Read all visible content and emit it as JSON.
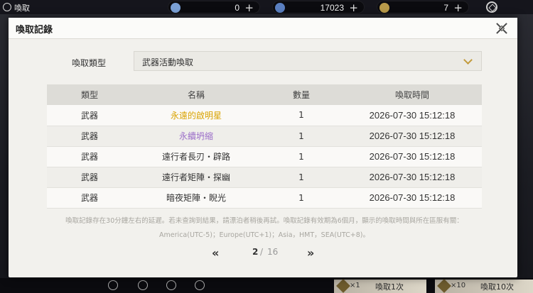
{
  "topbar": {
    "title": "喚取",
    "currencies": [
      {
        "icon": "crystal-icon",
        "value": "0",
        "color": "#7aa0d6"
      },
      {
        "icon": "star-shard-icon",
        "value": "17023",
        "color": "#5a7fc0"
      },
      {
        "icon": "weapon-ticket-icon",
        "value": "7",
        "color": "#b89a4a"
      }
    ]
  },
  "modal": {
    "title": "喚取記錄",
    "type_label": "喚取類型",
    "type_value": "武器活動喚取",
    "columns": [
      "類型",
      "名稱",
      "數量",
      "喚取時間"
    ],
    "rows": [
      {
        "type": "武器",
        "name": "永遠的啟明星",
        "qty": "1",
        "time": "2026-07-30 15:12:18",
        "rarity": "gold"
      },
      {
        "type": "武器",
        "name": "永續坍縮",
        "qty": "1",
        "time": "2026-07-30 15:12:18",
        "rarity": "purple"
      },
      {
        "type": "武器",
        "name": "遠行者長刃・辟路",
        "qty": "1",
        "time": "2026-07-30 15:12:18",
        "rarity": "normal"
      },
      {
        "type": "武器",
        "name": "遠行者矩陣・探幽",
        "qty": "1",
        "time": "2026-07-30 15:12:18",
        "rarity": "normal"
      },
      {
        "type": "武器",
        "name": "暗夜矩陣・睨光",
        "qty": "1",
        "time": "2026-07-30 15:12:18",
        "rarity": "normal"
      }
    ],
    "note_line1": "喚取記錄存在30分鐘左右的延遲。若未查詢到結果，請漂泊者稍後再試。喚取記錄有效期為6個月，顯示的喚取時間與所在區服有關：",
    "note_line2": "America(UTC-5)；Europe(UTC+1)；Asia，HMT，SEA(UTC+8)。",
    "pager": {
      "current": "2",
      "separator": "/",
      "total": "16"
    }
  },
  "bottom": {
    "pull_one_count": "×1",
    "pull_one_label": "喚取1次",
    "pull_ten_count": "×10",
    "pull_ten_label": "喚取10次"
  }
}
